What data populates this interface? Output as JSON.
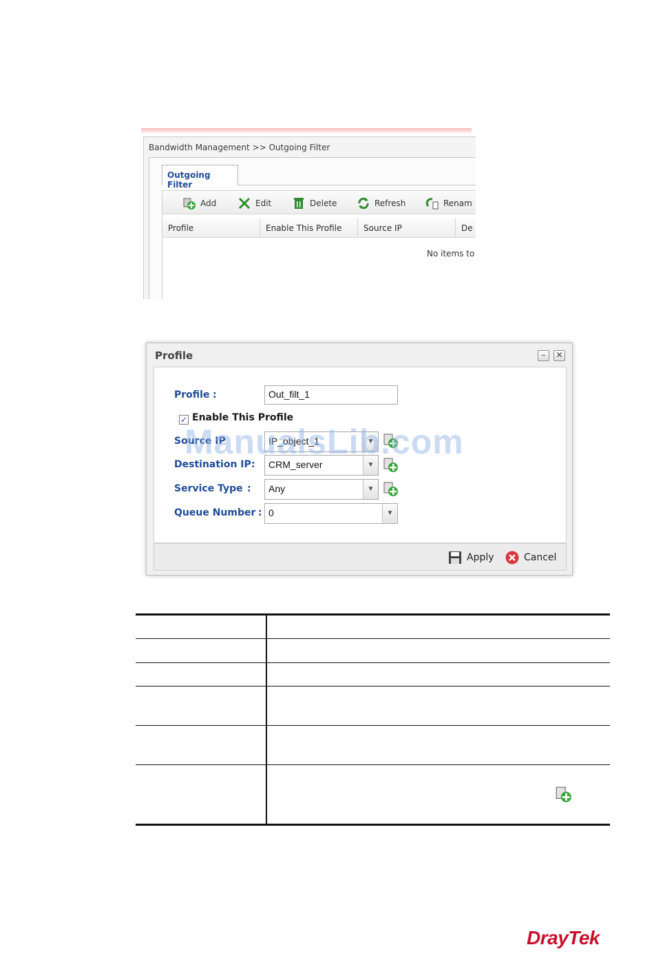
{
  "list_screen": {
    "breadcrumb": "Bandwidth Management >> Outgoing Filter",
    "tab": "Outgoing Filter",
    "toolbar": {
      "add": "Add",
      "edit": "Edit",
      "delete": "Delete",
      "refresh": "Refresh",
      "rename": "Renam"
    },
    "columns": [
      "Profile",
      "Enable This Profile",
      "Source IP",
      "De"
    ],
    "empty_text": "No items to"
  },
  "dialog": {
    "title": "Profile",
    "minimize": "–",
    "close": "✕",
    "fields": {
      "profile_label": "Profile",
      "profile_value": "Out_filt_1",
      "enable_label": "Enable This Profile",
      "enable_checked": true,
      "source_ip_label": "Source IP",
      "source_ip_value": "IP_object_1",
      "destination_ip_label": "Destination IP",
      "destination_ip_value": "CRM_server",
      "service_type_label": "Service Type",
      "service_type_value": "Any",
      "queue_number_label": "Queue Number",
      "queue_number_value": "0"
    },
    "buttons": {
      "apply": "Apply",
      "cancel": "Cancel"
    }
  },
  "watermark": "ManualsLib.com",
  "brand": "DrayTek",
  "colors": {
    "label_blue": "#1f4c96",
    "brand_red": "#c8102e",
    "add_icon_green": "#3aa63a"
  }
}
